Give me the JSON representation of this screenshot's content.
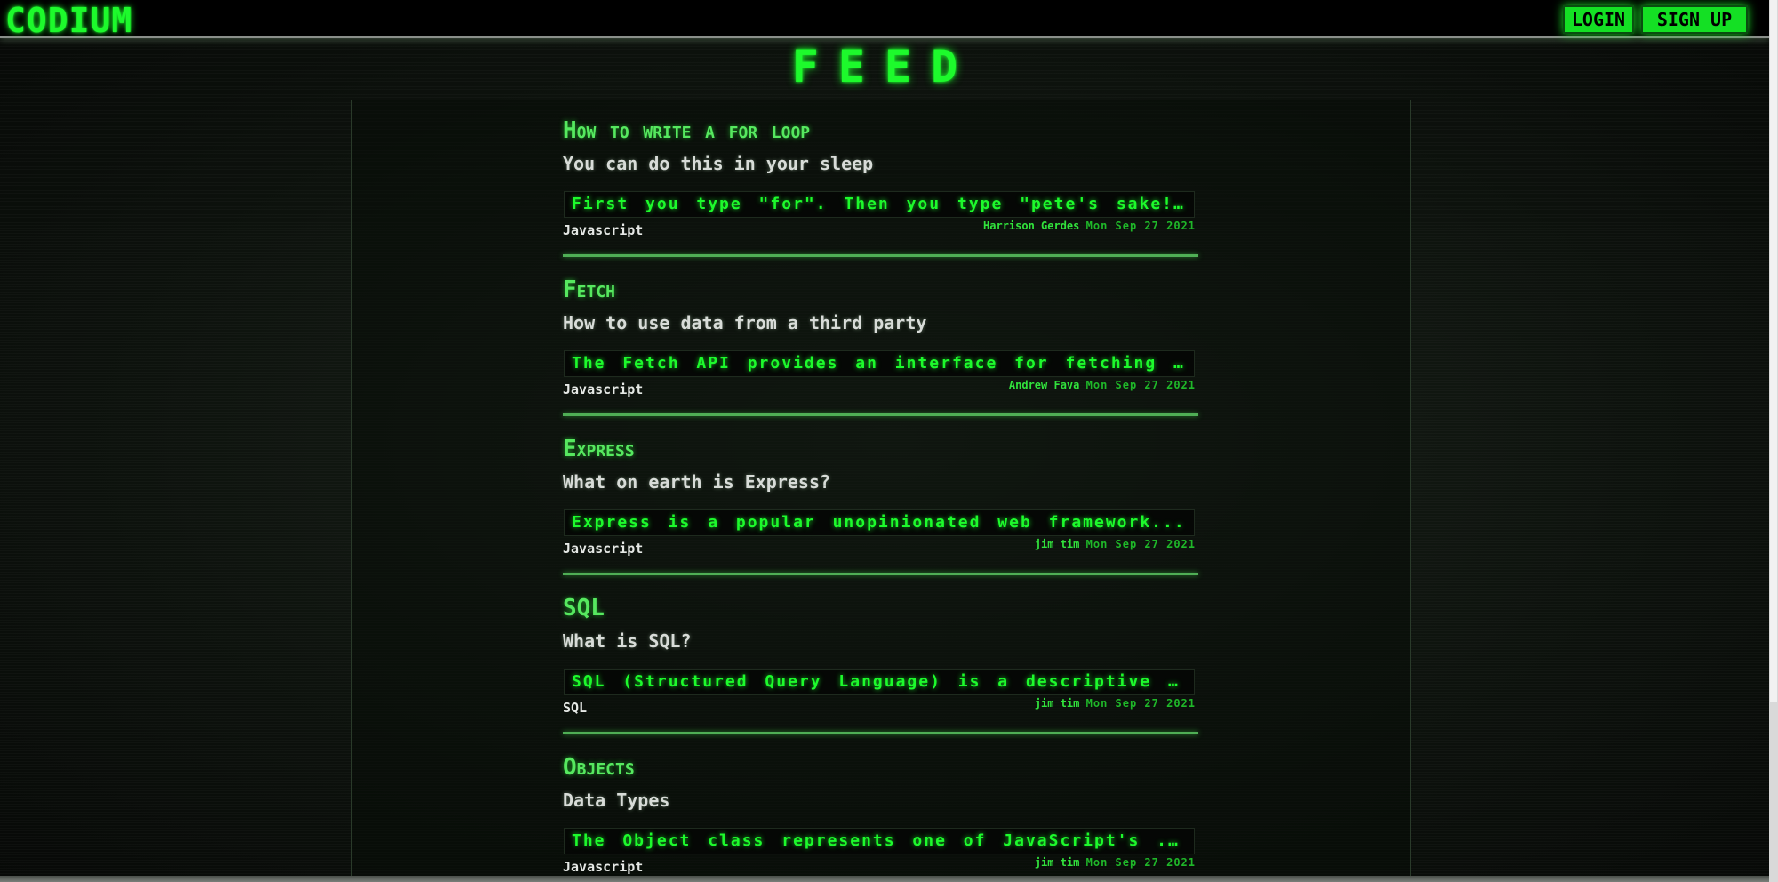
{
  "header": {
    "logo": "CODIUM",
    "login_label": "LOGIN",
    "signup_label": "SIGN UP"
  },
  "feed": {
    "title": "FEED",
    "posts": [
      {
        "title": "How to write a for loop",
        "subtitle": "You can do this in your sleep",
        "excerpt": "First you type \"for\". Then you type \"pete's sake!...",
        "tag": "Javascript",
        "author": "Harrison Gerdes",
        "date": "Mon Sep 27 2021"
      },
      {
        "title": "Fetch",
        "subtitle": "How to use data from a third party",
        "excerpt": "The Fetch API provides an interface for fetching ...",
        "tag": "Javascript",
        "author": "Andrew Fava",
        "date": "Mon Sep 27 2021"
      },
      {
        "title": "Express",
        "subtitle": "What on earth is Express?",
        "excerpt": "Express is a popular unopinionated web framework...",
        "tag": "Javascript",
        "author": "jim tim",
        "date": "Mon Sep 27 2021"
      },
      {
        "title": "SQL",
        "subtitle": "What is SQL?",
        "excerpt": "SQL (Structured Query Language) is a descriptive ...",
        "tag": "SQL",
        "author": "jim tim",
        "date": "Mon Sep 27 2021"
      },
      {
        "title": "Objects",
        "subtitle": "Data Types",
        "excerpt": "The Object class represents one of JavaScript's ...",
        "tag": "Javascript",
        "author": "jim tim",
        "date": "Mon Sep 27 2021"
      }
    ]
  },
  "colors": {
    "accent_green": "#1dfa2c",
    "background": "#0b0f0b",
    "topbar": "#000000"
  }
}
